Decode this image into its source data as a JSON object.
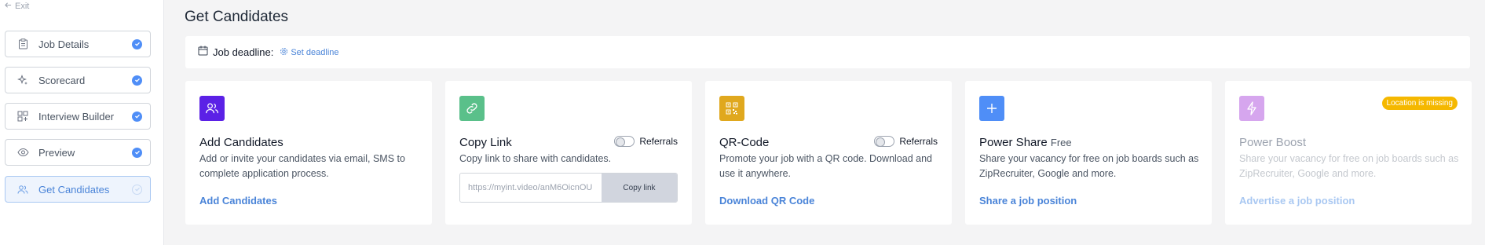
{
  "sidebar": {
    "exit_label": "Exit",
    "items": [
      {
        "label": "Job Details",
        "icon": "clipboard-icon",
        "active": false
      },
      {
        "label": "Scorecard",
        "icon": "sparkle-icon",
        "active": false
      },
      {
        "label": "Interview Builder",
        "icon": "grid-plus-icon",
        "active": false
      },
      {
        "label": "Preview",
        "icon": "eye-icon",
        "active": false
      },
      {
        "label": "Get Candidates",
        "icon": "users-icon",
        "active": true
      }
    ]
  },
  "main": {
    "title": "Get Candidates",
    "deadline": {
      "label": "Job deadline:",
      "link": "Set deadline"
    },
    "cards": {
      "add": {
        "title": "Add Candidates",
        "desc": "Add or invite your candidates via email, SMS to complete application process.",
        "link": "Add Candidates",
        "icon_color": "#5b21e6"
      },
      "copy": {
        "title": "Copy Link",
        "toggle_label": "Referrals",
        "desc": "Copy link to share with candidates.",
        "url": "https://myint.video/anM6OicnOU",
        "button": "Copy link",
        "icon_color": "#5ac08a"
      },
      "qr": {
        "title": "QR-Code",
        "toggle_label": "Referrals",
        "desc": "Promote your job with a QR code. Download and use it anywhere.",
        "link": "Download QR Code",
        "icon_color": "#e0a81e"
      },
      "share": {
        "title": "Power Share",
        "title_sub": "Free",
        "desc": "Share your vacancy for free on job boards such as ZipRecruiter, Google and more.",
        "link": "Share a job position",
        "icon_color": "#4f8ef7"
      },
      "boost": {
        "title": "Power Boost",
        "badge": "Location is missing",
        "desc": "Share your vacancy for free on job boards such as ZipRecruiter, Google and more.",
        "link": "Advertise a job position",
        "icon_color": "#d6a6ee"
      }
    }
  }
}
